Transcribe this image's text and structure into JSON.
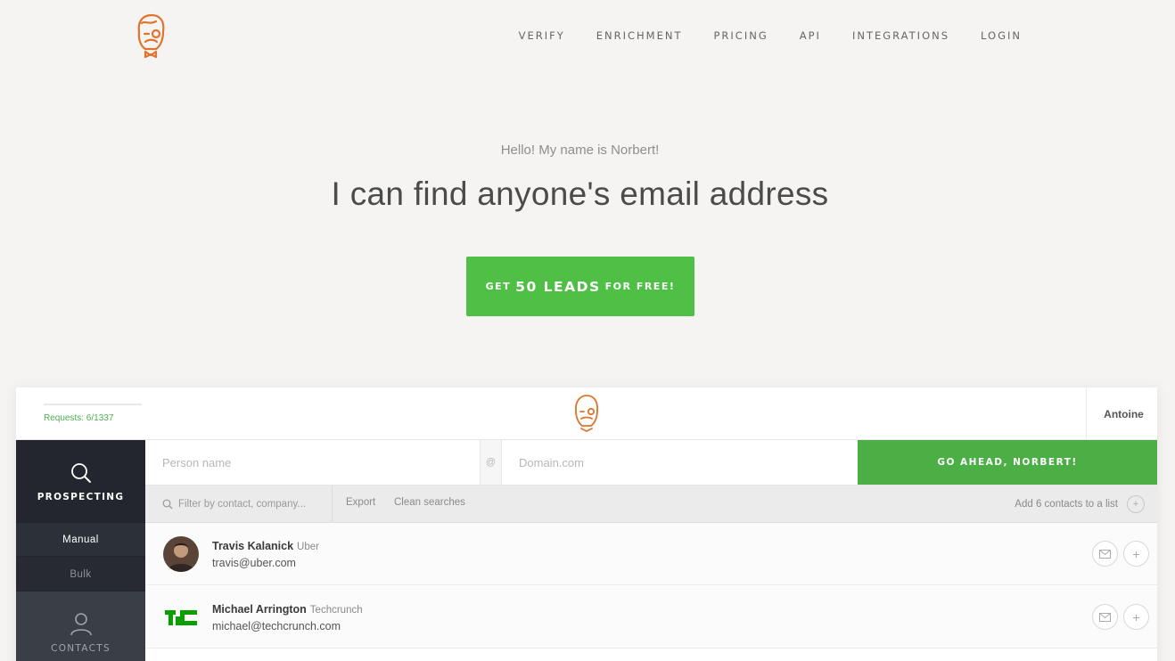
{
  "nav": {
    "items": [
      "VERIFY",
      "ENRICHMENT",
      "PRICING",
      "API",
      "INTEGRATIONS",
      "LOGIN"
    ]
  },
  "hero": {
    "greeting": "Hello! My name is Norbert!",
    "title": "I can find anyone's email address",
    "cta": {
      "pre": "GET",
      "main": "50 LEADS",
      "post": "FOR FREE!"
    }
  },
  "colors": {
    "accent_green": "#4fbf46",
    "logo_orange": "#e0732d",
    "sidebar_dark": "#23262e"
  },
  "app": {
    "requests": "Requests: 6/1337",
    "user": "Antoine",
    "sidebar": {
      "prospecting": "PROSPECTING",
      "manual": "Manual",
      "bulk": "Bulk",
      "contacts": "CONTACTS"
    },
    "search": {
      "person_placeholder": "Person name",
      "at": "@",
      "domain_placeholder": "Domain.com",
      "go": "GO AHEAD, NORBERT!"
    },
    "filter": {
      "placeholder": "Filter by contact, company...",
      "export": "Export",
      "clean": "Clean searches",
      "add_list": "Add 6 contacts to a list"
    },
    "rows": [
      {
        "name": "Travis Kalanick",
        "company": "Uber",
        "email": "travis@uber.com"
      },
      {
        "name": "Michael Arrington",
        "company": "Techcrunch",
        "email": "michael@techcrunch.com"
      }
    ]
  }
}
